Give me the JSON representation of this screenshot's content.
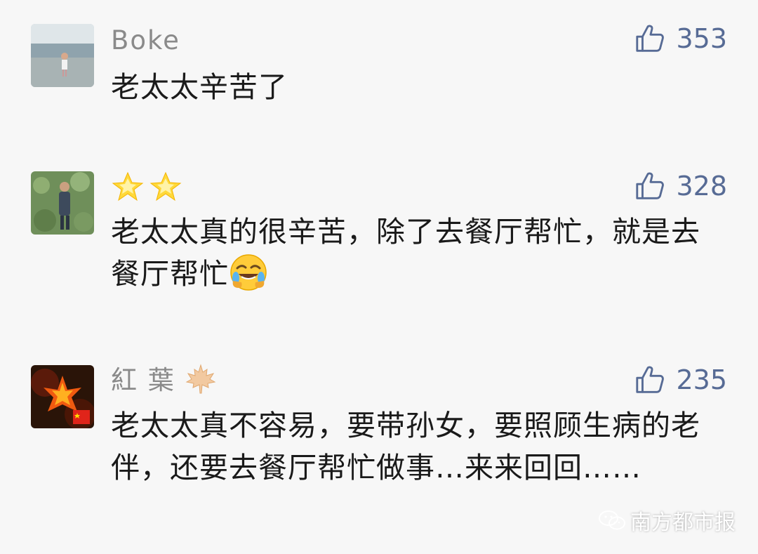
{
  "comments": [
    {
      "username": "Boke",
      "likes": "353",
      "text": "老太太辛苦了"
    },
    {
      "username_emoji": "star-emoji star-emoji",
      "likes": "328",
      "text": "老太太真的很辛苦，除了去餐厅帮忙，就是去餐厅帮忙",
      "trailing_emoji": "rolling-on-floor-laughing-emoji"
    },
    {
      "username": "紅 葉",
      "username_emoji": "maple-leaf-emoji",
      "likes": "235",
      "text": "老太太真不容易，要带孙女，要照顾生病的老伴，还要去餐厅帮忙做事…来来回回……"
    }
  ],
  "watermark": {
    "icon": "wechat-icon",
    "text": "南方都市报"
  },
  "colors": {
    "background": "#f7f7f7",
    "username": "#8a8a8a",
    "like_count": "#576b95",
    "body_text": "#1a1a1a"
  }
}
